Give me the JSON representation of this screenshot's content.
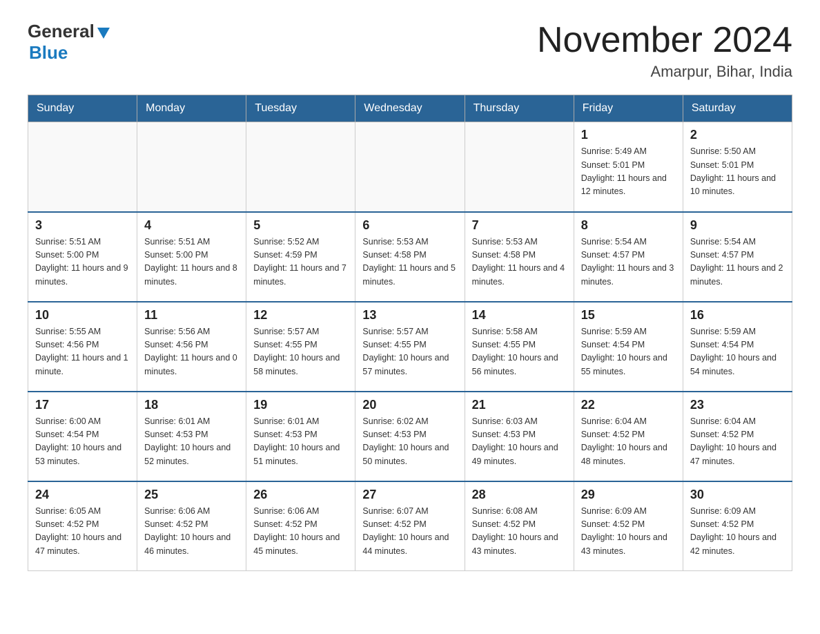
{
  "header": {
    "logo_general": "General",
    "logo_blue": "Blue",
    "month_title": "November 2024",
    "location": "Amarpur, Bihar, India"
  },
  "weekdays": [
    "Sunday",
    "Monday",
    "Tuesday",
    "Wednesday",
    "Thursday",
    "Friday",
    "Saturday"
  ],
  "weeks": [
    [
      {
        "day": "",
        "sunrise": "",
        "sunset": "",
        "daylight": ""
      },
      {
        "day": "",
        "sunrise": "",
        "sunset": "",
        "daylight": ""
      },
      {
        "day": "",
        "sunrise": "",
        "sunset": "",
        "daylight": ""
      },
      {
        "day": "",
        "sunrise": "",
        "sunset": "",
        "daylight": ""
      },
      {
        "day": "",
        "sunrise": "",
        "sunset": "",
        "daylight": ""
      },
      {
        "day": "1",
        "sunrise": "Sunrise: 5:49 AM",
        "sunset": "Sunset: 5:01 PM",
        "daylight": "Daylight: 11 hours and 12 minutes."
      },
      {
        "day": "2",
        "sunrise": "Sunrise: 5:50 AM",
        "sunset": "Sunset: 5:01 PM",
        "daylight": "Daylight: 11 hours and 10 minutes."
      }
    ],
    [
      {
        "day": "3",
        "sunrise": "Sunrise: 5:51 AM",
        "sunset": "Sunset: 5:00 PM",
        "daylight": "Daylight: 11 hours and 9 minutes."
      },
      {
        "day": "4",
        "sunrise": "Sunrise: 5:51 AM",
        "sunset": "Sunset: 5:00 PM",
        "daylight": "Daylight: 11 hours and 8 minutes."
      },
      {
        "day": "5",
        "sunrise": "Sunrise: 5:52 AM",
        "sunset": "Sunset: 4:59 PM",
        "daylight": "Daylight: 11 hours and 7 minutes."
      },
      {
        "day": "6",
        "sunrise": "Sunrise: 5:53 AM",
        "sunset": "Sunset: 4:58 PM",
        "daylight": "Daylight: 11 hours and 5 minutes."
      },
      {
        "day": "7",
        "sunrise": "Sunrise: 5:53 AM",
        "sunset": "Sunset: 4:58 PM",
        "daylight": "Daylight: 11 hours and 4 minutes."
      },
      {
        "day": "8",
        "sunrise": "Sunrise: 5:54 AM",
        "sunset": "Sunset: 4:57 PM",
        "daylight": "Daylight: 11 hours and 3 minutes."
      },
      {
        "day": "9",
        "sunrise": "Sunrise: 5:54 AM",
        "sunset": "Sunset: 4:57 PM",
        "daylight": "Daylight: 11 hours and 2 minutes."
      }
    ],
    [
      {
        "day": "10",
        "sunrise": "Sunrise: 5:55 AM",
        "sunset": "Sunset: 4:56 PM",
        "daylight": "Daylight: 11 hours and 1 minute."
      },
      {
        "day": "11",
        "sunrise": "Sunrise: 5:56 AM",
        "sunset": "Sunset: 4:56 PM",
        "daylight": "Daylight: 11 hours and 0 minutes."
      },
      {
        "day": "12",
        "sunrise": "Sunrise: 5:57 AM",
        "sunset": "Sunset: 4:55 PM",
        "daylight": "Daylight: 10 hours and 58 minutes."
      },
      {
        "day": "13",
        "sunrise": "Sunrise: 5:57 AM",
        "sunset": "Sunset: 4:55 PM",
        "daylight": "Daylight: 10 hours and 57 minutes."
      },
      {
        "day": "14",
        "sunrise": "Sunrise: 5:58 AM",
        "sunset": "Sunset: 4:55 PM",
        "daylight": "Daylight: 10 hours and 56 minutes."
      },
      {
        "day": "15",
        "sunrise": "Sunrise: 5:59 AM",
        "sunset": "Sunset: 4:54 PM",
        "daylight": "Daylight: 10 hours and 55 minutes."
      },
      {
        "day": "16",
        "sunrise": "Sunrise: 5:59 AM",
        "sunset": "Sunset: 4:54 PM",
        "daylight": "Daylight: 10 hours and 54 minutes."
      }
    ],
    [
      {
        "day": "17",
        "sunrise": "Sunrise: 6:00 AM",
        "sunset": "Sunset: 4:54 PM",
        "daylight": "Daylight: 10 hours and 53 minutes."
      },
      {
        "day": "18",
        "sunrise": "Sunrise: 6:01 AM",
        "sunset": "Sunset: 4:53 PM",
        "daylight": "Daylight: 10 hours and 52 minutes."
      },
      {
        "day": "19",
        "sunrise": "Sunrise: 6:01 AM",
        "sunset": "Sunset: 4:53 PM",
        "daylight": "Daylight: 10 hours and 51 minutes."
      },
      {
        "day": "20",
        "sunrise": "Sunrise: 6:02 AM",
        "sunset": "Sunset: 4:53 PM",
        "daylight": "Daylight: 10 hours and 50 minutes."
      },
      {
        "day": "21",
        "sunrise": "Sunrise: 6:03 AM",
        "sunset": "Sunset: 4:53 PM",
        "daylight": "Daylight: 10 hours and 49 minutes."
      },
      {
        "day": "22",
        "sunrise": "Sunrise: 6:04 AM",
        "sunset": "Sunset: 4:52 PM",
        "daylight": "Daylight: 10 hours and 48 minutes."
      },
      {
        "day": "23",
        "sunrise": "Sunrise: 6:04 AM",
        "sunset": "Sunset: 4:52 PM",
        "daylight": "Daylight: 10 hours and 47 minutes."
      }
    ],
    [
      {
        "day": "24",
        "sunrise": "Sunrise: 6:05 AM",
        "sunset": "Sunset: 4:52 PM",
        "daylight": "Daylight: 10 hours and 47 minutes."
      },
      {
        "day": "25",
        "sunrise": "Sunrise: 6:06 AM",
        "sunset": "Sunset: 4:52 PM",
        "daylight": "Daylight: 10 hours and 46 minutes."
      },
      {
        "day": "26",
        "sunrise": "Sunrise: 6:06 AM",
        "sunset": "Sunset: 4:52 PM",
        "daylight": "Daylight: 10 hours and 45 minutes."
      },
      {
        "day": "27",
        "sunrise": "Sunrise: 6:07 AM",
        "sunset": "Sunset: 4:52 PM",
        "daylight": "Daylight: 10 hours and 44 minutes."
      },
      {
        "day": "28",
        "sunrise": "Sunrise: 6:08 AM",
        "sunset": "Sunset: 4:52 PM",
        "daylight": "Daylight: 10 hours and 43 minutes."
      },
      {
        "day": "29",
        "sunrise": "Sunrise: 6:09 AM",
        "sunset": "Sunset: 4:52 PM",
        "daylight": "Daylight: 10 hours and 43 minutes."
      },
      {
        "day": "30",
        "sunrise": "Sunrise: 6:09 AM",
        "sunset": "Sunset: 4:52 PM",
        "daylight": "Daylight: 10 hours and 42 minutes."
      }
    ]
  ]
}
